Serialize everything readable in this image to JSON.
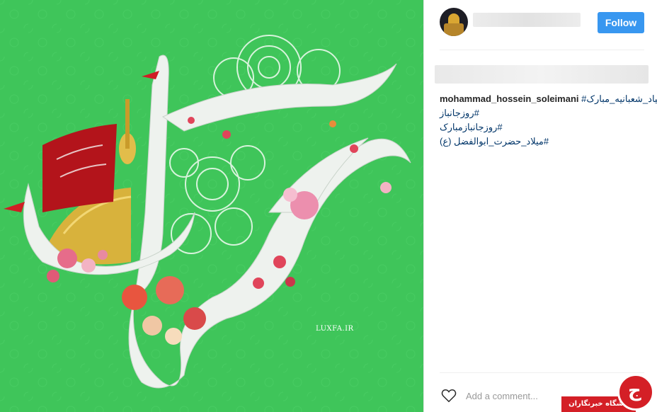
{
  "post": {
    "image_watermark": "LUXFA.IR",
    "colors": {
      "background_green": "#3fc55a",
      "calligraphy_white": "#eef2ee",
      "flag_red": "#b3141b",
      "dome_gold": "#d8b23c"
    }
  },
  "header": {
    "follow_label": "Follow",
    "avatar_icon": "shrine-avatar"
  },
  "caption": {
    "username": "mohammad_hossein_soleimani",
    "first_tag": "#اعیاد_شعبانیه_مبارک",
    "tags": [
      "#روزجانباز",
      "#روزجانبازمبارک",
      "#میلاد_حضرت_ابوالفضل (ع)"
    ]
  },
  "footer": {
    "add_comment_placeholder": "Add a comment...",
    "heart_icon": "heart-outline-icon"
  },
  "badge": {
    "label": "باشگاه خبرنگاران",
    "logo_glyph": "ج"
  }
}
